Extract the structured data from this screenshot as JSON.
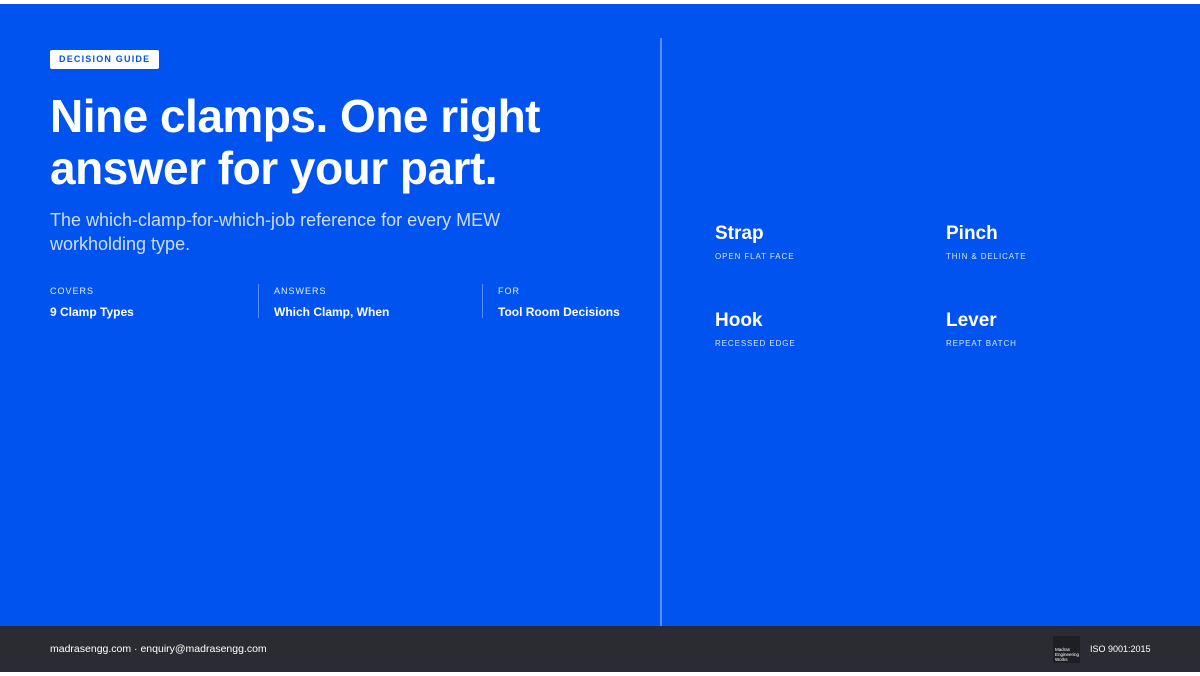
{
  "badge": "DECISION GUIDE",
  "headline": "Nine clamps. One right answer for your part.",
  "subtitle": "The which-clamp-for-which-job reference for every MEW workholding type.",
  "meta": [
    {
      "label": "COVERS",
      "value": "9 Clamp Types"
    },
    {
      "label": "ANSWERS",
      "value": "Which Clamp, When"
    },
    {
      "label": "FOR",
      "value": "Tool Room Decisions"
    }
  ],
  "clamp_types": [
    {
      "name": "Strap",
      "desc": "OPEN FLAT FACE"
    },
    {
      "name": "Pinch",
      "desc": "THIN & DELICATE"
    },
    {
      "name": "Hook",
      "desc": "RECESSED EDGE"
    },
    {
      "name": "Lever",
      "desc": "REPEAT BATCH"
    }
  ],
  "footer": {
    "contact": "madrasengg.com · enquiry@madrasengg.com",
    "logo_lines": [
      "Madras",
      "Engineering",
      "Works"
    ],
    "certification": "ISO 9001:2015"
  },
  "colors": {
    "background": "#0153f0",
    "footer": "#2b2c33",
    "text": "#ffffff"
  }
}
